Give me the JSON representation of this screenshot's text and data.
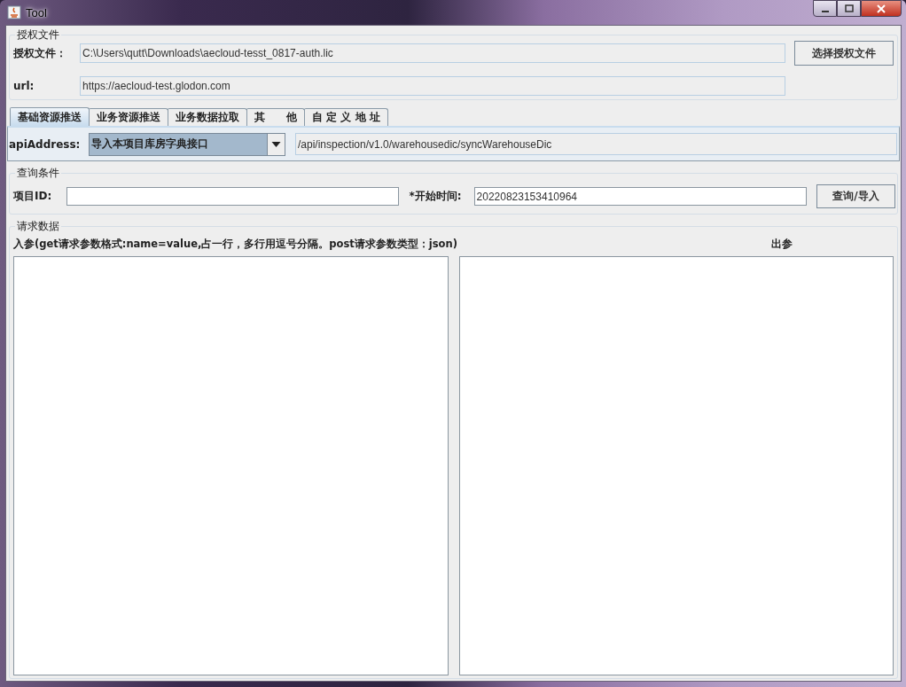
{
  "window": {
    "title": "Tool"
  },
  "license_group": {
    "title": "授权文件",
    "file_label": "授权文件：",
    "file_value": "C:\\Users\\qutt\\Downloads\\aecloud-tesst_0817-auth.lic",
    "choose_button": "选择授权文件",
    "url_label": "url:",
    "url_value": "https://aecloud-test.glodon.com"
  },
  "tabs": [
    {
      "label": "基础资源推送",
      "selected": true
    },
    {
      "label": "业务资源推送",
      "selected": false
    },
    {
      "label": "业务数据拉取",
      "selected": false
    },
    {
      "label": "其　　他",
      "selected": false
    },
    {
      "label": "自 定 义 地 址",
      "selected": false
    }
  ],
  "api": {
    "label": "apiAddress:",
    "selected_option": "导入本项目库房字典接口",
    "path": "/api/inspection/v1.0/warehousedic/syncWarehouseDic"
  },
  "query_group": {
    "title": "查询条件",
    "project_label": "项目ID:",
    "start_label": "*开始时间:",
    "start_value": "20220823153410964",
    "query_button": "查询/导入"
  },
  "request_group": {
    "title": "请求数据",
    "input_label": "入参(get请求参数格式:name=value,占一行，多行用逗号分隔。post请求参数类型：json)",
    "output_label": "出参"
  }
}
